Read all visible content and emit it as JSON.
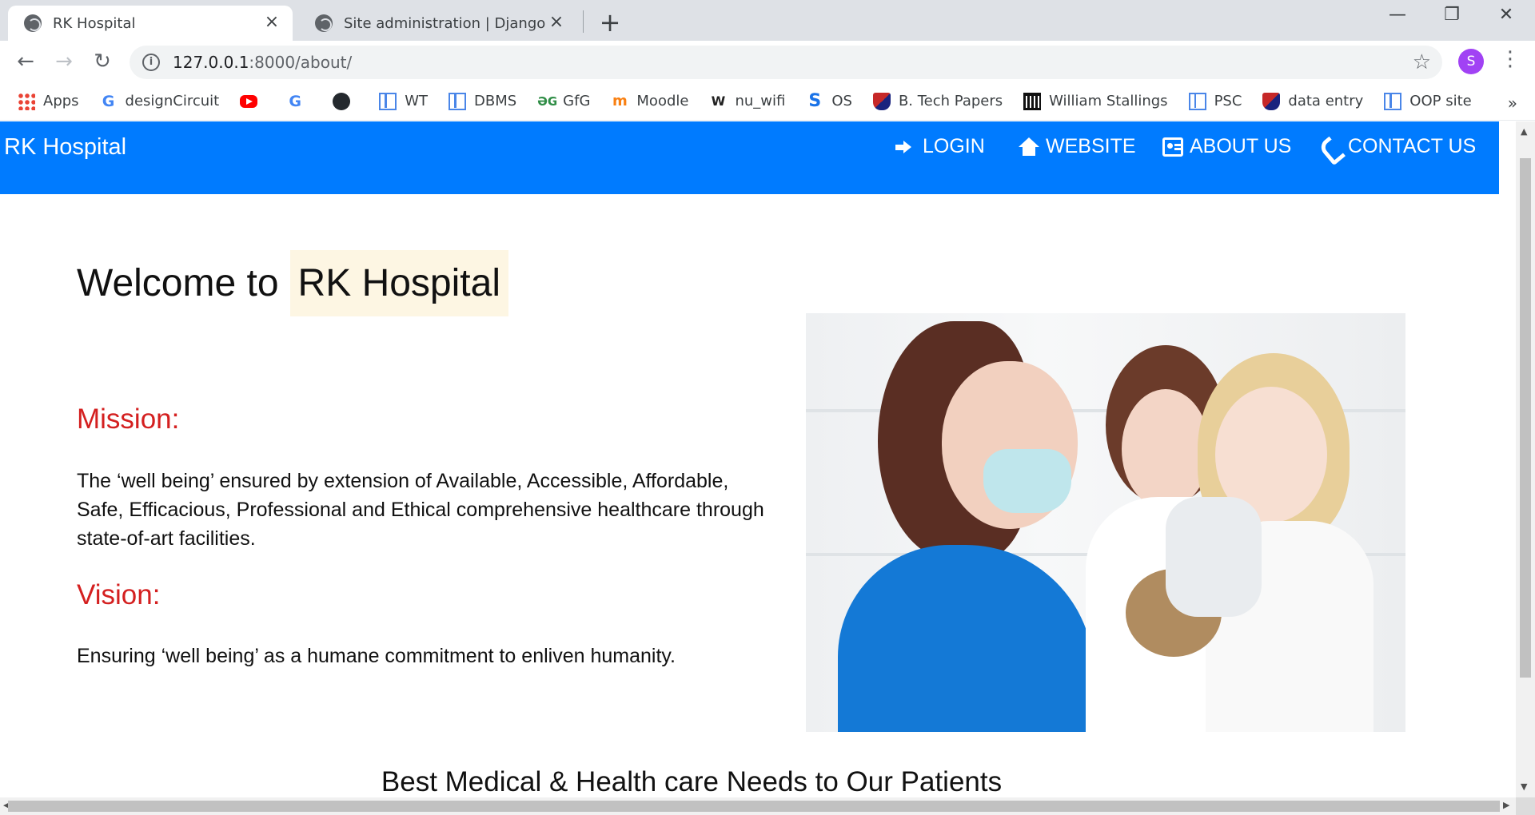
{
  "browser": {
    "tabs": [
      {
        "title": "RK Hospital",
        "active": true
      },
      {
        "title": "Site administration | Django site admin",
        "active": false
      }
    ],
    "url_host": "127.0.0.1",
    "url_rest": ":8000/about/",
    "profile_initial": "S",
    "bookmarks": [
      {
        "label": "Apps",
        "icon": "apps-grid-icon"
      },
      {
        "label": "designCircuit",
        "icon": "google-icon"
      },
      {
        "label": "",
        "icon": "youtube-icon"
      },
      {
        "label": "",
        "icon": "google-icon"
      },
      {
        "label": "",
        "icon": "github-icon"
      },
      {
        "label": "WT",
        "icon": "page-icon"
      },
      {
        "label": "DBMS",
        "icon": "page-icon"
      },
      {
        "label": "GfG",
        "icon": "gfg-icon"
      },
      {
        "label": "Moodle",
        "icon": "moodle-icon"
      },
      {
        "label": "nu_wifi",
        "icon": "w-icon"
      },
      {
        "label": "OS",
        "icon": "s-icon"
      },
      {
        "label": "B. Tech Papers",
        "icon": "shield-icon"
      },
      {
        "label": "William Stallings",
        "icon": "pillars-icon"
      },
      {
        "label": "PSC",
        "icon": "page-icon"
      },
      {
        "label": "data entry",
        "icon": "shield-icon"
      },
      {
        "label": "OOP site",
        "icon": "page-icon"
      }
    ],
    "bookmarks_more": "»"
  },
  "site": {
    "brand": "RK Hospital",
    "nav": [
      {
        "label": "LOGIN",
        "icon": "sign-in-icon"
      },
      {
        "label": "WEBSITE",
        "icon": "home-icon"
      },
      {
        "label": "ABOUT US",
        "icon": "id-card-icon"
      },
      {
        "label": "CONTACT US",
        "icon": "phone-icon"
      }
    ]
  },
  "about": {
    "welcome_prefix": "Welcome to",
    "welcome_highlight": "RK Hospital",
    "mission_heading": "Mission:",
    "mission_text": "The ‘well being’ ensured by extension of Available, Accessible, Affordable, Safe, Efficacious, Professional and Ethical comprehensive healthcare through state-of-art facilities.",
    "vision_heading": "Vision:",
    "vision_text": "Ensuring ‘well being’ as a humane commitment to enliven humanity.",
    "bottom_heading": "Best Medical & Health care Needs to Our Patients"
  },
  "colors": {
    "navbar": "#007bff",
    "section_heading": "#d42020",
    "welcome_highlight_bg": "#fdf6e3"
  }
}
